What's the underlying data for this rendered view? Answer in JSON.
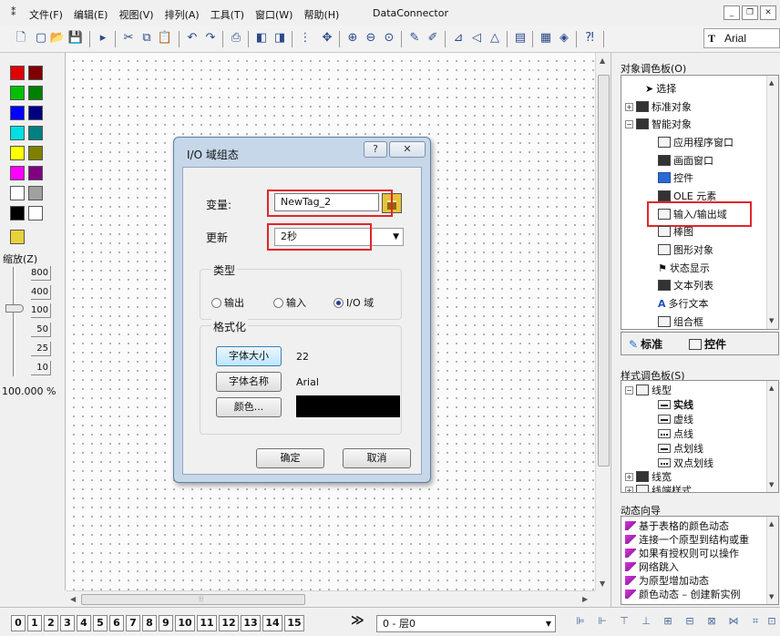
{
  "menubar": {
    "items": [
      "文件(F)",
      "编辑(E)",
      "视图(V)",
      "排列(A)",
      "工具(T)",
      "窗口(W)",
      "帮助(H)"
    ],
    "title": "DataConnector"
  },
  "toolbar": {
    "font_name": "Arial"
  },
  "palette": {
    "colors": [
      "#e00000",
      "#800000",
      "#00c000",
      "#008000",
      "#0000ff",
      "#000080",
      "#00e0e0",
      "#008080",
      "#ffff00",
      "#808000",
      "#ff00ff",
      "#800080",
      "#ffffff",
      "#a0a0a0",
      "#000000",
      "#ffffff"
    ],
    "zoom_label": "缩放(Z)",
    "zoom_levels": [
      "800",
      "400",
      "100",
      "50",
      "25",
      "10"
    ],
    "zoom_current": "100.000 %"
  },
  "dialog": {
    "title": "I/O 域组态",
    "help_glyph": "?",
    "variable_label": "变量:",
    "variable_value": "NewTag_2",
    "update_label": "更新",
    "update_value": "2秒",
    "type_group": "类型",
    "radio_output": "输出",
    "radio_input": "输入",
    "radio_io": "I/O 域",
    "format_group": "格式化",
    "font_size_btn": "字体大小",
    "font_size_val": "22",
    "font_name_btn": "字体名称",
    "font_name_val": "Arial",
    "color_btn": "颜色...",
    "color_value": "#000000",
    "ok": "确定",
    "cancel": "取消"
  },
  "object_palette": {
    "title": "对象调色板(O)",
    "items": [
      "选择",
      "标准对象",
      "智能对象",
      "应用程序窗口",
      "画面窗口",
      "控件",
      "OLE 元素",
      "输入/输出域",
      "棒图",
      "图形对象",
      "状态显示",
      "文本列表",
      "多行文本",
      "组合框"
    ],
    "tab_standard": "标准",
    "tab_controls": "控件"
  },
  "style_palette": {
    "title": "样式调色板(S)",
    "items": [
      "线型",
      "实线",
      "虚线",
      "点线",
      "点划线",
      "双点划线",
      "线宽",
      "线端样式"
    ]
  },
  "dynamic_wizard": {
    "title": "动态向导",
    "items": [
      "基于表格的颜色动态",
      "连接一个原型到结构或重",
      "如果有授权则可以操作",
      "网络跳入",
      "为原型增加动态",
      "颜色动态 – 创建新实例"
    ]
  },
  "layerbar": {
    "layers": [
      "0",
      "1",
      "2",
      "3",
      "4",
      "5",
      "6",
      "7",
      "8",
      "9",
      "10",
      "11",
      "12",
      "13",
      "14",
      "15"
    ],
    "more": "≫",
    "current_layer": "0 - 层0"
  }
}
